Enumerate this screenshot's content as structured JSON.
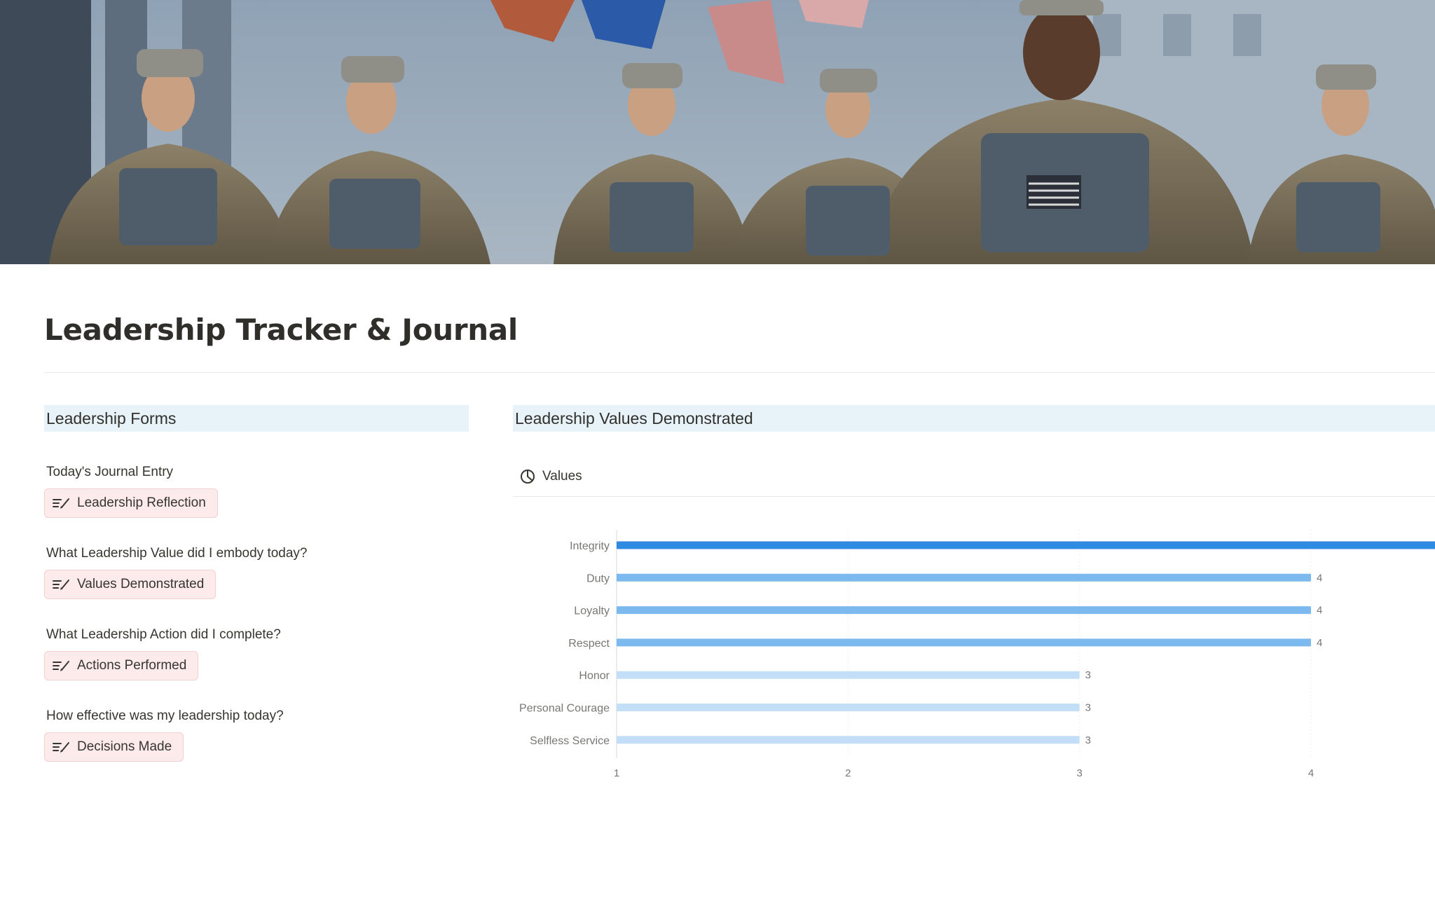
{
  "page": {
    "title": "Leadership Tracker & Journal"
  },
  "forms_section": {
    "header": "Leadership Forms",
    "items": [
      {
        "question": "Today's Journal Entry",
        "button_label": "Leadership Reflection",
        "icon": "form-edit-icon"
      },
      {
        "question": "What Leadership Value did I embody today?",
        "button_label": "Values Demonstrated",
        "icon": "form-edit-icon"
      },
      {
        "question": "What Leadership Action did I complete?",
        "button_label": "Actions Performed",
        "icon": "form-edit-icon"
      },
      {
        "question": "How effective was my leadership today?",
        "button_label": "Decisions Made",
        "icon": "form-edit-icon"
      }
    ]
  },
  "values_section": {
    "header": "Leadership Values Demonstrated",
    "view_tab": {
      "label": "Values",
      "icon": "chart-pie-icon"
    }
  },
  "colors": {
    "section_header_bg": "#e7f3f8",
    "form_button_bg": "#fdebec",
    "bar_dark": "#2f8ae2",
    "bar_mid": "#7cb9ee",
    "bar_light": "#c2dff7"
  },
  "chart_data": {
    "type": "bar",
    "orientation": "horizontal",
    "categories": [
      "Integrity",
      "Duty",
      "Loyalty",
      "Respect",
      "Honor",
      "Personal Courage",
      "Selfless Service"
    ],
    "values": [
      5,
      4,
      4,
      4,
      3,
      3,
      3
    ],
    "data_labels": [
      "",
      "4",
      "4",
      "4",
      "3",
      "3",
      "3"
    ],
    "x_ticks": [
      1,
      2,
      3,
      4
    ],
    "xlim": [
      1,
      5
    ],
    "grid": true,
    "legend": "none"
  }
}
